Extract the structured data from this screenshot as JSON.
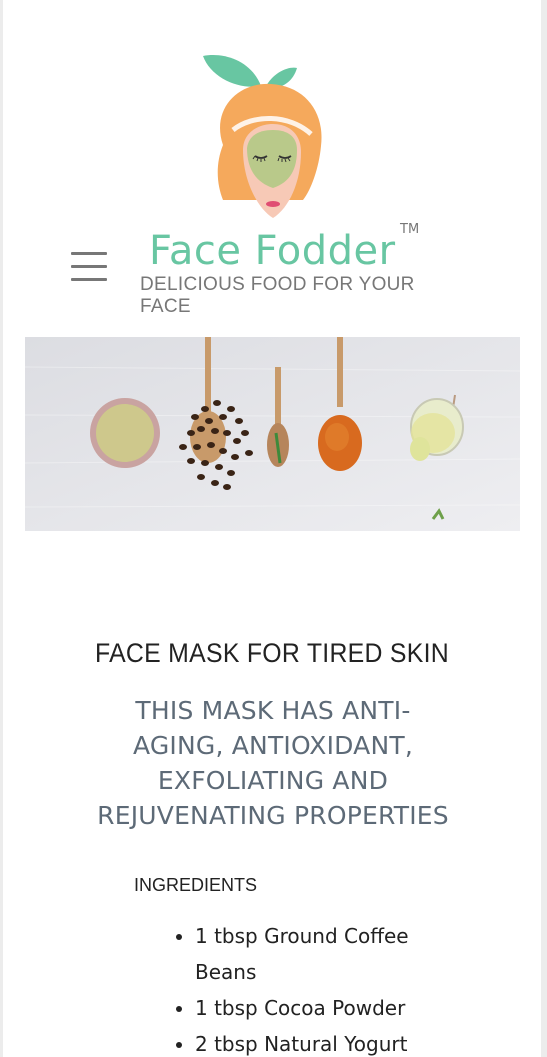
{
  "brand": {
    "name": "Face Fodder",
    "trademark": "TM",
    "tagline": "DELICIOUS FOOD FOR YOUR FACE"
  },
  "colors": {
    "brand_green": "#68c6a2",
    "brand_orange": "#f5a95c",
    "subtitle_gray": "#5d6a77"
  },
  "hero": {
    "items": [
      "clay powder bowl",
      "coffee beans",
      "cocoa spoon",
      "turmeric spoon",
      "oil glass"
    ]
  },
  "article": {
    "title": "FACE MASK FOR TIRED SKIN",
    "subtitle": "THIS MASK HAS ANTI-AGING, ANTIOXIDANT, EXFOLIATING AND REJUVENATING PROPERTIES"
  },
  "ingredients": {
    "heading": "INGREDIENTS",
    "items": [
      "1 tbsp Ground Coffee Beans",
      "1 tbsp Cocoa Powder",
      "2 tbsp Natural Yogurt"
    ]
  }
}
